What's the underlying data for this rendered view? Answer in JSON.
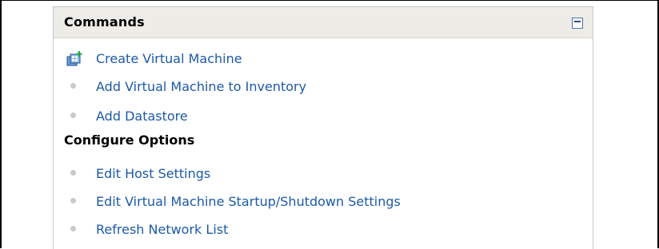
{
  "panel": {
    "title": "Commands"
  },
  "commands": [
    {
      "label": "Create Virtual Machine",
      "icon": "create-vm-icon"
    },
    {
      "label": "Add Virtual Machine to Inventory",
      "icon": "bullet"
    },
    {
      "label": "Add Datastore",
      "icon": "bullet"
    }
  ],
  "configure": {
    "heading": "Configure Options",
    "items": [
      {
        "label": "Edit Host Settings"
      },
      {
        "label": "Edit Virtual Machine Startup/Shutdown Settings"
      },
      {
        "label": "Refresh Network List"
      }
    ]
  },
  "colors": {
    "link": "#1c5aa8",
    "header_bg": "#edece6",
    "bullet": "#c9c9c9"
  }
}
